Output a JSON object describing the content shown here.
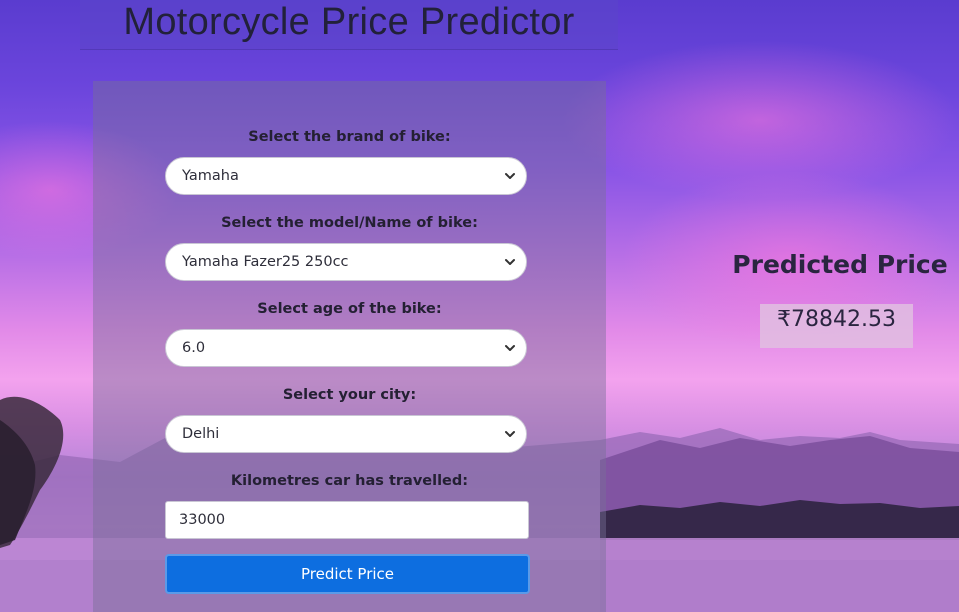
{
  "page": {
    "title": "Motorcycle Price Predictor"
  },
  "form": {
    "brand": {
      "label": "Select the brand of bike:",
      "value": "Yamaha"
    },
    "model": {
      "label": "Select the model/Name of bike:",
      "value": "Yamaha Fazer25 250cc"
    },
    "age": {
      "label": "Select age of the bike:",
      "value": "6.0"
    },
    "city": {
      "label": "Select your city:",
      "value": "Delhi"
    },
    "kms": {
      "label": "Kilometres car has travelled:",
      "value": "33000"
    },
    "submit_label": "Predict Price"
  },
  "result": {
    "title": "Predicted Price",
    "value": "₹78842.53"
  },
  "colors": {
    "button": "#0d6ee0",
    "sky_top": "#5a3ccf",
    "sky_glow": "#f3a2ee"
  },
  "icons": {
    "select_arrow": "chevron-down-icon"
  }
}
